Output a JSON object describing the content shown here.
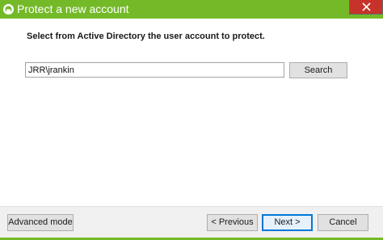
{
  "window": {
    "title": "Protect a new account",
    "accent_color": "#74ba28",
    "close_color": "#c7332b"
  },
  "icons": {
    "app": "app-logo-icon",
    "close": "close-icon"
  },
  "main": {
    "instruction": "Select from Active Directory the user account to protect.",
    "account_input": {
      "value": "JRR\\jrankin"
    },
    "search_label": "Search"
  },
  "footer": {
    "advanced_label": "Advanced mode",
    "previous_label": "< Previous",
    "next_label": "Next >",
    "cancel_label": "Cancel"
  }
}
